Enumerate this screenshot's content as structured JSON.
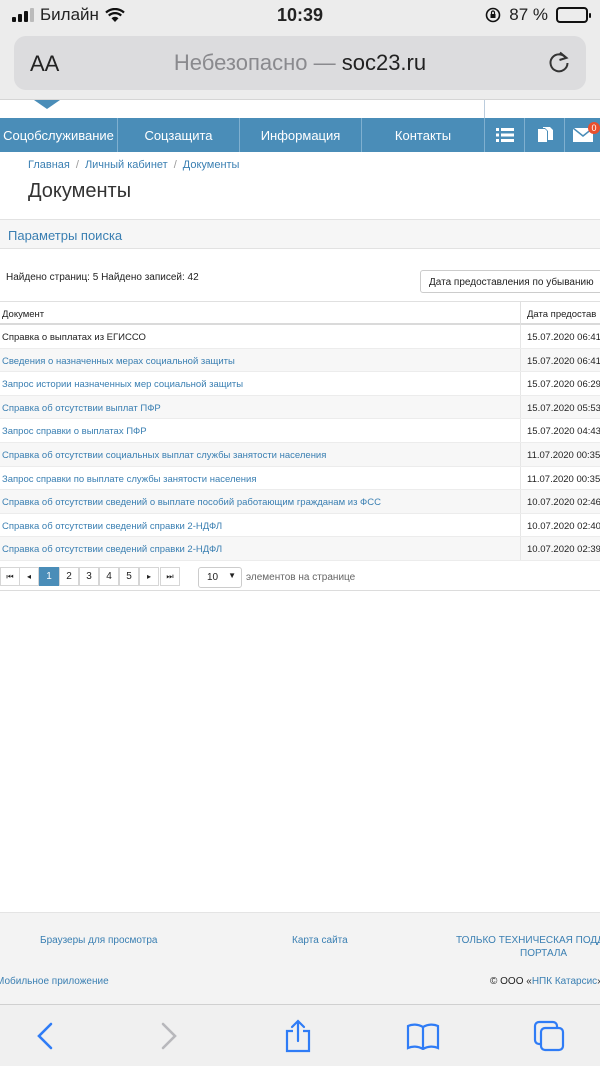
{
  "status": {
    "carrier": "Билайн",
    "time": "10:39",
    "battery_text": "87 %",
    "battery_level": 0.87
  },
  "browser": {
    "aa_label": "AA",
    "url_prefix": "Небезопасно —",
    "url_domain": "soc23.ru"
  },
  "nav": {
    "items": [
      "Соцобслуживание",
      "Соцзащита",
      "Информация",
      "Контакты"
    ],
    "badge": "0"
  },
  "breadcrumb": [
    "Главная",
    "Личный кабинет",
    "Документы"
  ],
  "page_title": "Документы",
  "search_panel": "Параметры поиска",
  "found_text": "Найдено страниц: 5 Найдено записей: 42",
  "sort_label": "Дата предоставления по убыванию",
  "table": {
    "headers": [
      "Документ",
      "Дата предостав"
    ],
    "rows": [
      {
        "doc": "Справка о выплатах из ЕГИССО",
        "date": "15.07.2020 06:41"
      },
      {
        "doc": "Сведения о назначенных мерах социальной защиты",
        "date": "15.07.2020 06:41"
      },
      {
        "doc": "Запрос истории назначенных мер социальной защиты",
        "date": "15.07.2020 06:29"
      },
      {
        "doc": "Справка об отсутствии выплат ПФР",
        "date": "15.07.2020 05:53"
      },
      {
        "doc": "Запрос справки о выплатах ПФР",
        "date": "15.07.2020 04:43"
      },
      {
        "doc": "Справка об отсутствии социальных выплат службы занятости населения",
        "date": "11.07.2020 00:35"
      },
      {
        "doc": "Запрос справки по выплате службы занятости населения",
        "date": "11.07.2020 00:35"
      },
      {
        "doc": "Справка об отсутствии сведений о выплате пособий работающим гражданам из ФСС",
        "date": "10.07.2020 02:46"
      },
      {
        "doc": "Справка об отсутствии сведений справки 2-НДФЛ",
        "date": "10.07.2020 02:40"
      },
      {
        "doc": "Справка об отсутствии сведений справки 2-НДФЛ",
        "date": "10.07.2020 02:39"
      }
    ]
  },
  "pager": {
    "first": "⏮",
    "prev": "◂",
    "next": "▸",
    "last": "⏭",
    "pages": [
      "1",
      "2",
      "3",
      "4",
      "5"
    ],
    "per_page": "10",
    "per_page_label": "элементов на странице"
  },
  "footer": {
    "browsers": "Браузеры для просмотра",
    "sitemap": "Карта сайта",
    "support_line1": "ТОЛЬКО ТЕХНИЧЕСКАЯ ПОДДЕ",
    "support_line2": "ПОРТАЛА",
    "mobile_app": "Мобильное приложение",
    "copyright_pre": "© ООО «",
    "copyright_link": "НПК Катарсис",
    "copyright_post": "»,"
  },
  "colors": {
    "accent": "#4a8db8",
    "link": "#3a7fb2",
    "ios_blue": "#2f7cf6"
  }
}
